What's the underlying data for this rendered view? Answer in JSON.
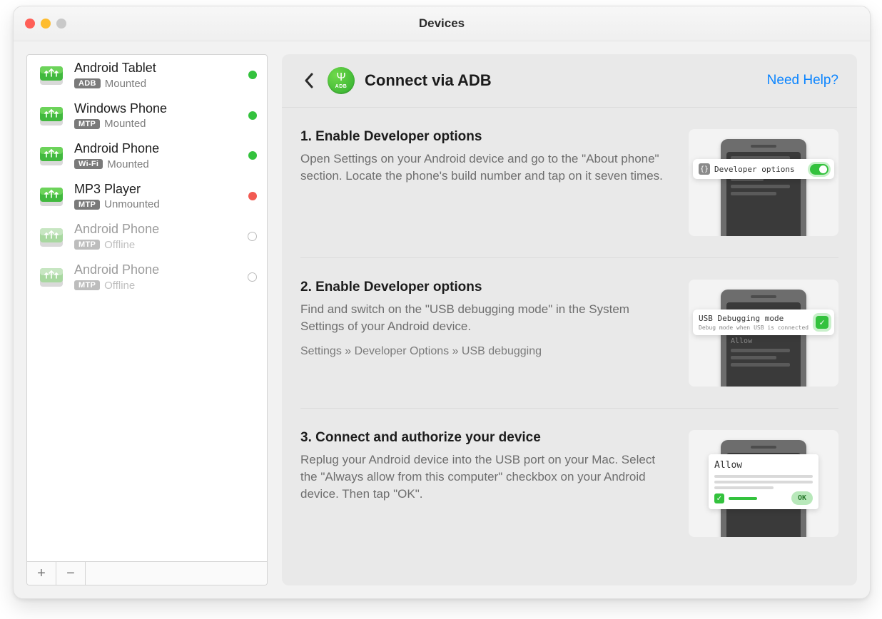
{
  "window": {
    "title": "Devices"
  },
  "sidebar": {
    "devices": [
      {
        "name": "Android Tablet",
        "protocol": "ADB",
        "state": "Mounted",
        "status": "green",
        "dim": false
      },
      {
        "name": "Windows Phone",
        "protocol": "MTP",
        "state": "Mounted",
        "status": "green",
        "dim": false
      },
      {
        "name": "Android Phone",
        "protocol": "Wi-Fi",
        "state": "Mounted",
        "status": "green",
        "dim": false
      },
      {
        "name": "MP3 Player",
        "protocol": "MTP",
        "state": "Unmounted",
        "status": "red",
        "dim": false
      },
      {
        "name": "Android Phone",
        "protocol": "MTP",
        "state": "Offline",
        "status": "hollow",
        "dim": true
      },
      {
        "name": "Android Phone",
        "protocol": "MTP",
        "state": "Offline",
        "status": "hollow",
        "dim": true
      }
    ],
    "add_symbol": "+",
    "remove_symbol": "−"
  },
  "detail": {
    "title": "Connect via ADB",
    "adb_badge_text": "ADB",
    "help_link": "Need Help?",
    "steps": [
      {
        "title": "1. Enable Developer options",
        "desc": "Open Settings on your Android device and go to the \"About phone\" section. Locate the phone's build number and tap on it seven times.",
        "path": "",
        "illus": {
          "chip_label": "Developer options",
          "chip_kind": "toggle"
        }
      },
      {
        "title": "2. Enable Developer options",
        "desc": "Find and switch on the \"USB debugging mode\" in the System Settings of your Android device.",
        "path": "Settings » Developer Options » USB debugging",
        "illus": {
          "chip_label": "USB Debugging mode",
          "chip_sub": "Debug mode when USB is connected",
          "chip_kind": "check",
          "allow_strip": "Allow"
        }
      },
      {
        "title": "3. Connect and authorize your device",
        "desc": "Replug your Android device into the USB port on your Mac. Select the \"Always allow from this computer\" checkbox on your Android device. Then tap \"OK\".",
        "path": "",
        "illus": {
          "allow_title": "Allow",
          "ok_label": "OK"
        }
      }
    ]
  }
}
